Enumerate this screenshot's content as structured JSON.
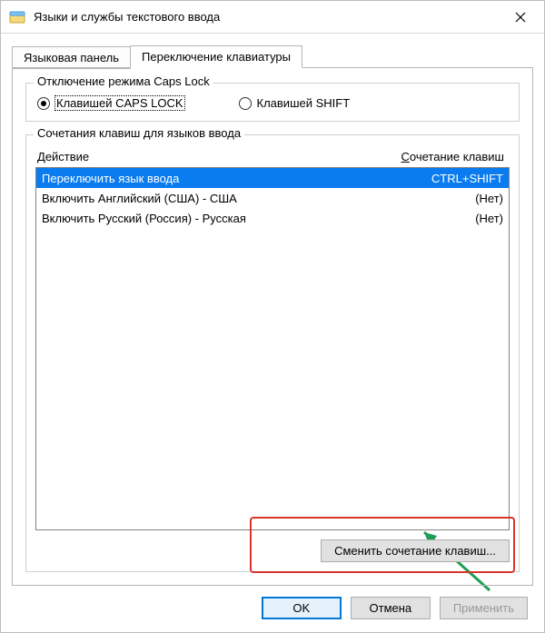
{
  "window": {
    "title": "Языки и службы текстового ввода"
  },
  "tabs": {
    "language_bar": "Языковая панель",
    "switch_keyboard": "Переключение клавиатуры"
  },
  "capslock_group": {
    "legend": "Отключение режима Caps Lock",
    "opt_capslock": "Клавишей CAPS LOCK",
    "opt_shift": "Клавишей SHIFT"
  },
  "hotkeys_group": {
    "legend": "Сочетания клавиш для языков ввода",
    "header_action_pre": "Д",
    "header_action_rest": "ействие",
    "header_combo_pre": "С",
    "header_combo_rest": "очетание клавиш",
    "rows": [
      {
        "action": "Переключить язык ввода",
        "combo": "CTRL+SHIFT",
        "selected": true
      },
      {
        "action": "Включить Английский (США) - США",
        "combo": "(Нет)",
        "selected": false
      },
      {
        "action": "Включить Русский (Россия) - Русская",
        "combo": "(Нет)",
        "selected": false
      }
    ],
    "change_button": "Сменить сочетание клавиш..."
  },
  "buttons": {
    "ok": "OK",
    "cancel": "Отмена",
    "apply": "Применить"
  }
}
